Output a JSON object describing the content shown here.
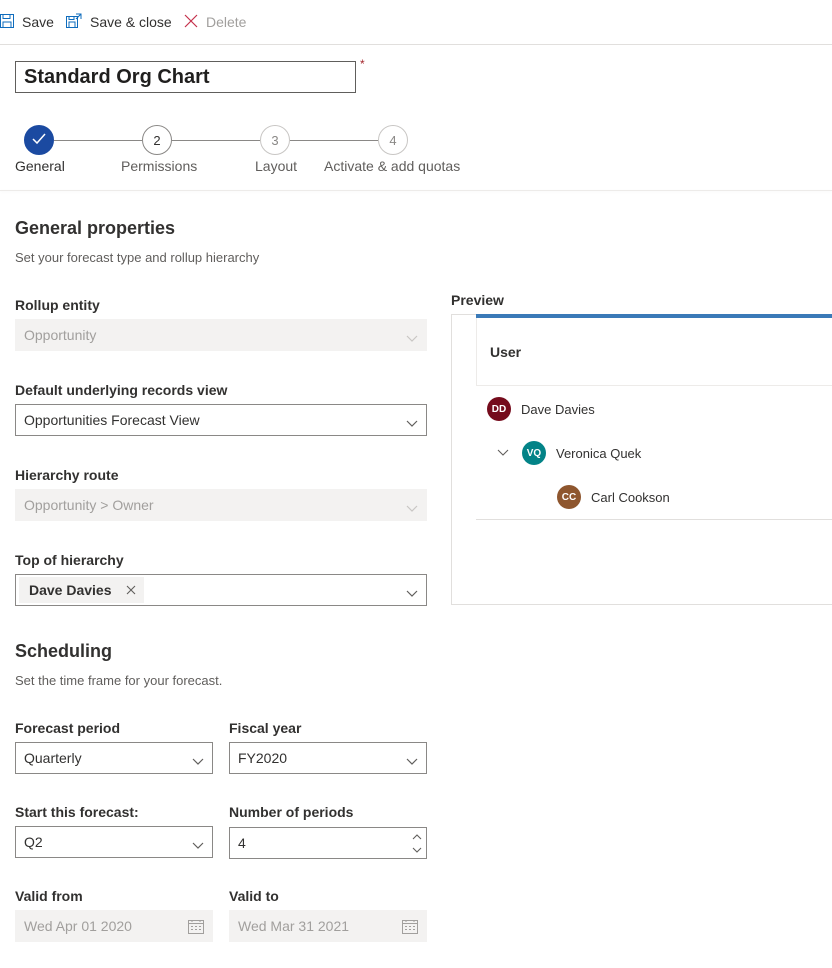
{
  "toolbar": {
    "save_label": "Save",
    "save_close_label": "Save & close",
    "delete_label": "Delete"
  },
  "title": {
    "value": "Standard Org Chart",
    "required_mark": "*"
  },
  "steps": [
    {
      "number": "",
      "label": "General",
      "state": "done"
    },
    {
      "number": "2",
      "label": "Permissions",
      "state": "next"
    },
    {
      "number": "3",
      "label": "Layout",
      "state": "future"
    },
    {
      "number": "4",
      "label": "Activate & add quotas",
      "state": "future"
    }
  ],
  "general": {
    "heading": "General properties",
    "subtitle": "Set your forecast type and rollup hierarchy",
    "rollup_entity": {
      "label": "Rollup entity",
      "value": "Opportunity"
    },
    "default_view": {
      "label": "Default underlying records view",
      "value": "Opportunities Forecast View"
    },
    "hierarchy_route": {
      "label": "Hierarchy route",
      "value": "Opportunity > Owner"
    },
    "top_of_hierarchy": {
      "label": "Top of hierarchy",
      "tag": "Dave Davies"
    }
  },
  "preview": {
    "label": "Preview",
    "column_header": "User",
    "rows": [
      {
        "initials": "DD",
        "name": "Dave Davies",
        "color": "#750b1c"
      },
      {
        "initials": "VQ",
        "name": "Veronica Quek",
        "color": "#038387"
      },
      {
        "initials": "CC",
        "name": "Carl Cookson",
        "color": "#8e562e"
      }
    ]
  },
  "scheduling": {
    "heading": "Scheduling",
    "subtitle": "Set the time frame for your forecast.",
    "forecast_period": {
      "label": "Forecast period",
      "value": "Quarterly"
    },
    "fiscal_year": {
      "label": "Fiscal year",
      "value": "FY2020"
    },
    "start_forecast": {
      "label": "Start this forecast:",
      "value": "Q2"
    },
    "number_of_periods": {
      "label": "Number of periods",
      "value": "4"
    },
    "valid_from": {
      "label": "Valid from",
      "value": "Wed Apr 01 2020"
    },
    "valid_to": {
      "label": "Valid to",
      "value": "Wed Mar 31 2021"
    }
  },
  "colors": {
    "accent": "#1b4aa1",
    "preview_bar": "#3a7ab8",
    "required": "#a4262c"
  },
  "icons": {
    "save": "save-icon",
    "save_close": "save-close-icon",
    "delete": "close-icon",
    "dropdown": "chevron-down-icon",
    "calendar": "calendar-icon",
    "check": "checkmark-icon"
  }
}
